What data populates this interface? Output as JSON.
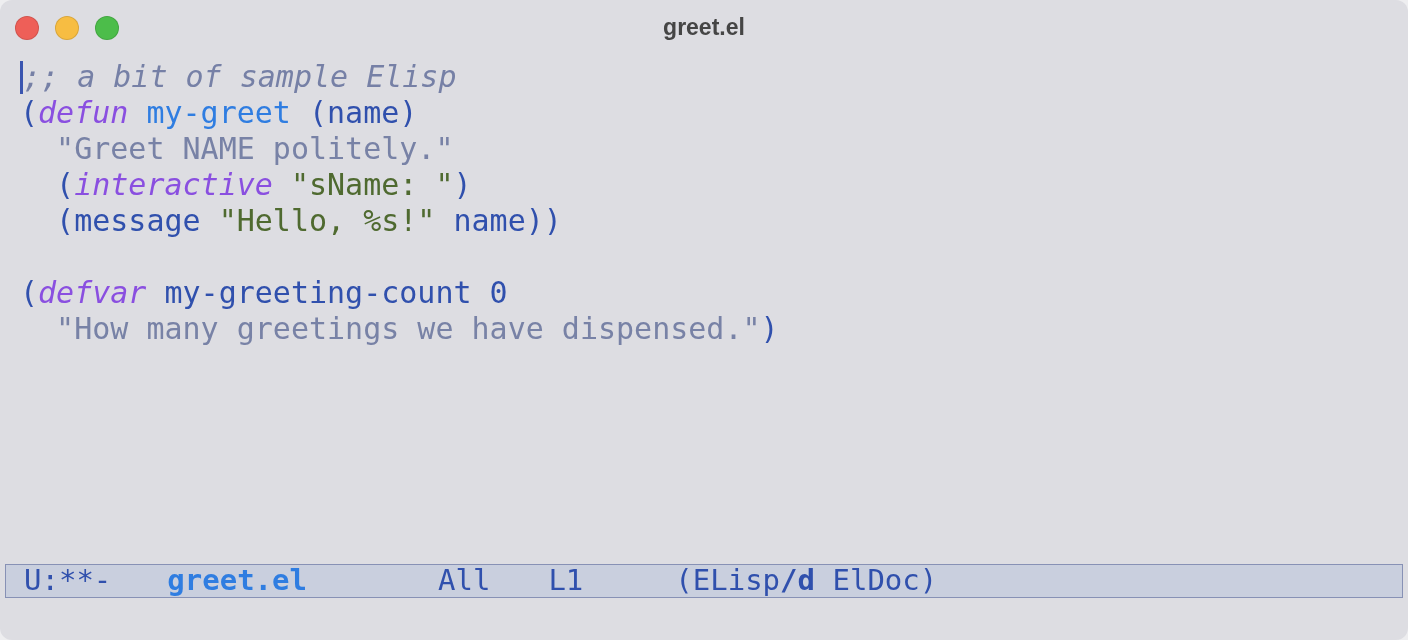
{
  "window": {
    "title": "greet.el"
  },
  "buffer": {
    "blocks": [
      {
        "lines": [
          {
            "cursor": true,
            "tokens": [
              {
                "text": ";; a bit of sample Elisp",
                "kind": "comment"
              }
            ]
          },
          {
            "cursor": false,
            "tokens": [
              {
                "text": "(",
                "kind": "plain"
              },
              {
                "text": "defun",
                "kind": "keyword"
              },
              {
                "text": " my-greet",
                "kind": "function-name"
              },
              {
                "text": " (name)",
                "kind": "plain"
              }
            ]
          },
          {
            "cursor": false,
            "tokens": [
              {
                "text": "  \"Greet NAME politely.\"",
                "kind": "doc"
              }
            ]
          },
          {
            "cursor": false,
            "tokens": [
              {
                "text": "  (",
                "kind": "plain"
              },
              {
                "text": "interactive",
                "kind": "keyword"
              },
              {
                "text": " \"sName: \"",
                "kind": "string"
              },
              {
                "text": ")",
                "kind": "plain"
              }
            ]
          },
          {
            "cursor": false,
            "tokens": [
              {
                "text": "  (message ",
                "kind": "plain"
              },
              {
                "text": "\"Hello, %s!\"",
                "kind": "string"
              },
              {
                "text": " name))",
                "kind": "plain"
              }
            ]
          }
        ]
      },
      {
        "lines": [
          {
            "cursor": false,
            "tokens": [
              {
                "text": "(",
                "kind": "plain"
              },
              {
                "text": "defvar",
                "kind": "keyword"
              },
              {
                "text": " my-greeting-count 0",
                "kind": "plain"
              }
            ]
          },
          {
            "cursor": false,
            "tokens": [
              {
                "text": "  \"How many greetings we have dispensed.\"",
                "kind": "doc"
              },
              {
                "text": ")",
                "kind": "plain"
              }
            ]
          }
        ]
      }
    ]
  },
  "mode_line": {
    "segments": [
      {
        "kind": "status",
        "text": "U:**-"
      },
      {
        "kind": "buffer-name",
        "text": "greet.el"
      },
      {
        "kind": "position",
        "text": "All"
      },
      {
        "kind": "line",
        "text": "L1"
      },
      {
        "kind": "modes",
        "text": "(ELisp**/d** ElDoc)"
      }
    ]
  }
}
